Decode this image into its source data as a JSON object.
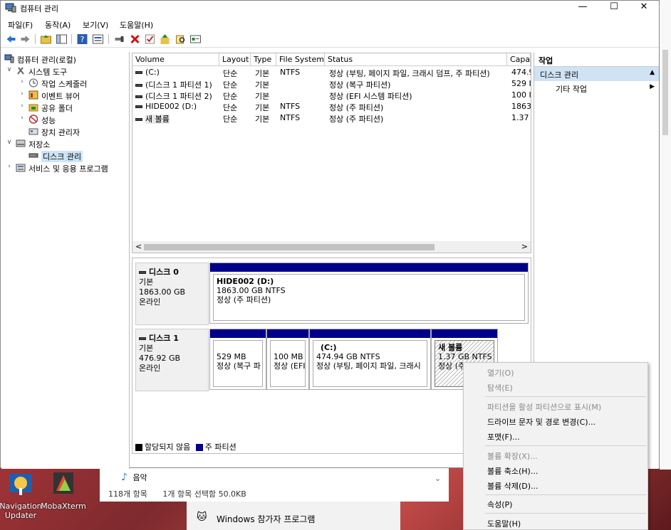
{
  "window": {
    "title": "컴퓨터 관리",
    "minimize_glyph": "—",
    "maximize_glyph": "☐",
    "close_glyph": "✕"
  },
  "menu": [
    "파일(F)",
    "동작(A)",
    "보기(V)",
    "도움말(H)"
  ],
  "toolbar_icons": [
    "back-icon",
    "forward-icon",
    "up-folder-icon",
    "show-hide-tree-icon",
    "help-icon",
    "properties-icon",
    "connect-icon",
    "delete-icon",
    "check-icon",
    "import-icon",
    "find-icon",
    "export-list-icon"
  ],
  "tree": {
    "root": "컴퓨터 관리(로컬)",
    "system_tools": "시스템 도구",
    "task_scheduler": "작업 스케줄러",
    "event_viewer": "이벤트 뷰어",
    "shared_folders": "공유 폴더",
    "performance": "성능",
    "device_manager": "장치 관리자",
    "storage": "저장소",
    "disk_management": "디스크 관리",
    "services": "서비스 및 응용 프로그램"
  },
  "list": {
    "columns": [
      "Volume",
      "Layout",
      "Type",
      "File System",
      "Status",
      "Capa"
    ],
    "rows": [
      {
        "volume": "(C:)",
        "layout": "단순",
        "type": "기본",
        "fs": "NTFS",
        "status": "정상 (부팅, 페이지 파일, 크래시 덤프, 주 파티션)",
        "cap": "474.9"
      },
      {
        "volume": "(디스크 1 파티션 1)",
        "layout": "단순",
        "type": "기본",
        "fs": "",
        "status": "정상 (복구 파티션)",
        "cap": "529 I"
      },
      {
        "volume": "(디스크 1 파티션 2)",
        "layout": "단순",
        "type": "기본",
        "fs": "",
        "status": "정상 (EFI 시스템 파티션)",
        "cap": "100 I"
      },
      {
        "volume": "HIDE002 (D:)",
        "layout": "단순",
        "type": "기본",
        "fs": "NTFS",
        "status": "정상 (주 파티션)",
        "cap": "1863"
      },
      {
        "volume": "새 볼륨",
        "layout": "단순",
        "type": "기본",
        "fs": "NTFS",
        "status": "정상 (주 파티션)",
        "cap": "1.37"
      }
    ],
    "scroll_left": "<",
    "scroll_right": ">"
  },
  "disks": [
    {
      "name": "디스크 0",
      "kind": "기본",
      "size": "1863.00 GB",
      "state": "온라인",
      "partitions": [
        {
          "title": "HIDE002  (D:)",
          "line1": "1863.00 GB NTFS",
          "line2": "정상 (주 파티션)"
        }
      ]
    },
    {
      "name": "디스크 1",
      "kind": "기본",
      "size": "476.92 GB",
      "state": "온라인",
      "partitions": [
        {
          "title": "",
          "line1": "529 MB",
          "line2": "정상 (복구 파"
        },
        {
          "title": "",
          "line1": "100 MB",
          "line2": "정상 (EFI"
        },
        {
          "title": "(C:)",
          "line1": "474.94 GB NTFS",
          "line2": "정상 (부팅, 페이지 파일, 크래시"
        },
        {
          "title": "새 볼륨",
          "line1": "1.37 GB NTFS",
          "line2": "정상 (주 파"
        }
      ]
    }
  ],
  "legend": {
    "unallocated": "할당되지 않음",
    "primary": "주 파티션",
    "unallocated_color": "#000000",
    "primary_color": "#00008b"
  },
  "actions": {
    "header": "작업",
    "group": "디스크 관리",
    "more": "기타 작업",
    "collapse_glyph": "▲",
    "expand_glyph": "▶"
  },
  "context_menu": {
    "open": "열기(O)",
    "explore": "탐색(E)",
    "mark_active": "파티션을 활성 파티션으로 표시(M)",
    "change_letter": "드라이브 문자 및 경로 변경(C)...",
    "format": "포맷(F)...",
    "extend": "볼륨 확장(X)...",
    "shrink": "볼륨 축소(H)...",
    "delete": "볼륨 삭제(D)...",
    "properties": "속성(P)",
    "help": "도움말(H)"
  },
  "behind_window": {
    "music": "음악",
    "items": "118개 항목",
    "selected": "1개 항목 선택함 50.0KB",
    "chevron": "⌄"
  },
  "taskband": {
    "label": "Windows 참가자 프로그램",
    "icon": "🐱"
  },
  "desktop_icons": [
    {
      "label": "Navigation Updater"
    },
    {
      "label": "MobaXterm"
    }
  ]
}
